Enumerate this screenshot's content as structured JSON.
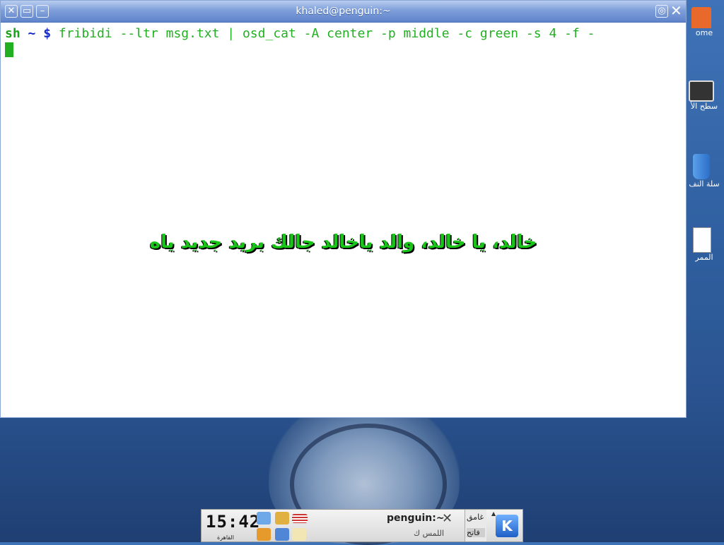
{
  "window": {
    "title": "khaled@penguin:~",
    "left_buttons": [
      "close",
      "maximize",
      "minimize"
    ],
    "right_buttons": [
      "sticky",
      "close"
    ]
  },
  "terminal": {
    "prompt_host": "sh",
    "prompt_path": " ~ ",
    "prompt_symbol": "$",
    "command": " fribidi --ltr msg.txt | osd_cat -A center -p middle -c green -s 4 -f -",
    "osd_text": "خالد، يا خالد، والد ياخالد جالك بريد جديد ياه"
  },
  "desktop_icons": [
    {
      "label": "ome",
      "icon": "home-icon"
    },
    {
      "label": "سطح الأ",
      "icon": "monitor-icon"
    },
    {
      "label": "سلة النف",
      "icon": "trash-icon"
    },
    {
      "label": "الممر",
      "icon": "file-icon"
    }
  ],
  "panel": {
    "clock_time": "15:42",
    "clock_location": "القاهرة",
    "task_title": "penguin:~",
    "task_subtitle": "اللمس ك",
    "pager_desktop_1": "غامق",
    "pager_desktop_2": "فاتح",
    "kde_label": "K"
  },
  "colors": {
    "prompt_green": "#1aa51a",
    "prompt_blue": "#1428c8",
    "osd_green": "#17c417"
  }
}
